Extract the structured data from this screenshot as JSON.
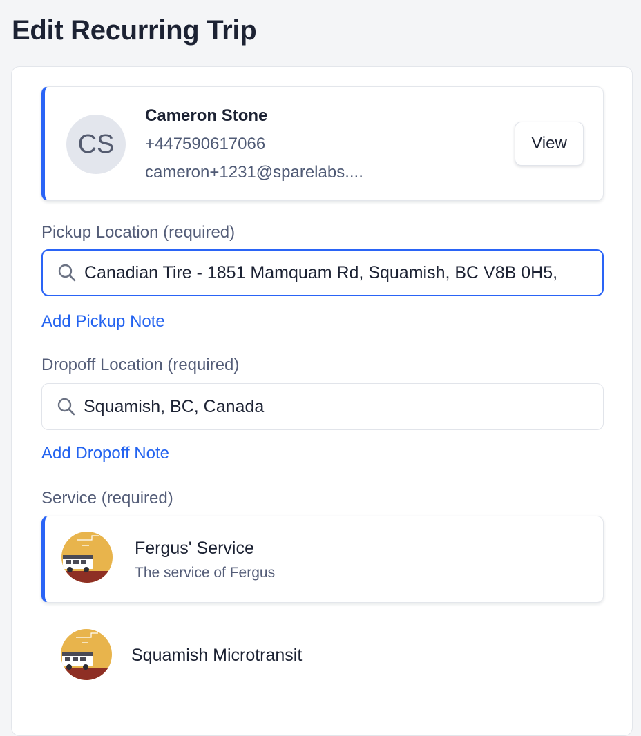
{
  "page": {
    "title": "Edit Recurring Trip"
  },
  "rider": {
    "initials": "CS",
    "name": "Cameron Stone",
    "phone": "+447590617066",
    "email": "cameron+1231@sparelabs....",
    "view_label": "View"
  },
  "pickup": {
    "label": "Pickup Location (required)",
    "value": "Canadian Tire - 1851 Mamquam Rd, Squamish, BC V8B 0H5,",
    "add_note_label": "Add Pickup Note"
  },
  "dropoff": {
    "label": "Dropoff Location (required)",
    "value": "Squamish, BC, Canada",
    "add_note_label": "Add Dropoff Note"
  },
  "service": {
    "label": "Service (required)",
    "options": [
      {
        "name": "Fergus' Service",
        "description": "The service of Fergus",
        "selected": true,
        "icon": "bus-logo-icon"
      },
      {
        "name": "Squamish Microtransit",
        "description": "",
        "selected": false,
        "icon": "bus-logo-icon"
      }
    ]
  },
  "colors": {
    "accent": "#2a64f6",
    "link": "#2363f0",
    "logo_yellow": "#e8b44c",
    "logo_red": "#8e2f24"
  }
}
